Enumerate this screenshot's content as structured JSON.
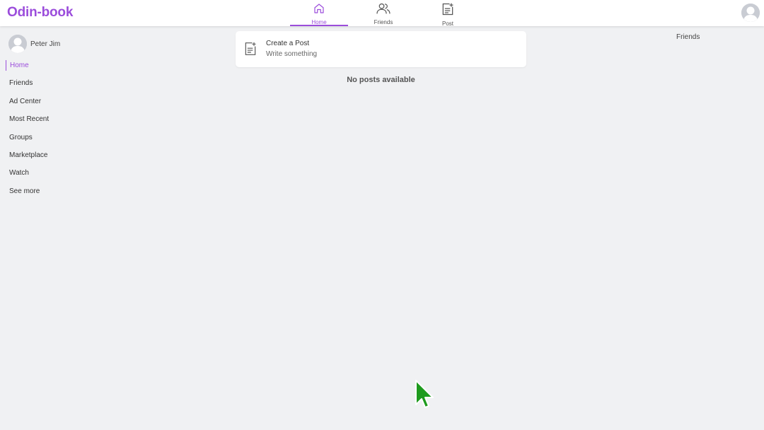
{
  "brand": {
    "name": "Odin-book",
    "color": "#9b4ddb"
  },
  "topnav": {
    "tabs": [
      {
        "label": "Home",
        "icon": "home-icon",
        "active": true
      },
      {
        "label": "Friends",
        "icon": "friends-icon",
        "active": false
      },
      {
        "label": "Post",
        "icon": "post-icon",
        "active": false
      }
    ]
  },
  "user": {
    "name": "Peter Jim",
    "avatar_icon": "user-avatar-icon"
  },
  "sidebar": {
    "items": [
      {
        "label": "Home",
        "active": true
      },
      {
        "label": "Friends"
      },
      {
        "label": "Ad Center"
      },
      {
        "label": "Most Recent"
      },
      {
        "label": "Groups"
      },
      {
        "label": "Marketplace"
      },
      {
        "label": "Watch"
      },
      {
        "label": "See more"
      }
    ]
  },
  "composer": {
    "title": "Create a Post",
    "subtitle": "Write something",
    "icon": "create-post-icon"
  },
  "feed": {
    "empty_message": "No posts available"
  },
  "rightpanel": {
    "heading": "Friends"
  },
  "colors": {
    "accent": "#9b4ddb",
    "background": "#f0f1f3",
    "surface": "#ffffff"
  }
}
